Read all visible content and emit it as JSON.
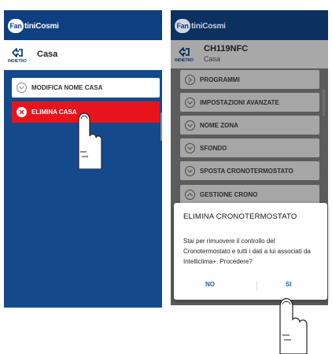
{
  "brand": {
    "logo_badge": "Fan",
    "logo_text": "tiniCosmi"
  },
  "colors": {
    "header_blue": "#0e3f80",
    "danger_red": "#e8141c",
    "dialog_button": "#1f5ea8"
  },
  "left_screen": {
    "back_label": "INDIETRO",
    "title": "Casa",
    "menu": [
      {
        "label": "MODIFICA NOME CASA",
        "icon": "chevron-down-icon"
      },
      {
        "label": "ELIMINA CASA",
        "icon": "close-icon"
      }
    ]
  },
  "right_screen": {
    "back_label": "INDIETRO",
    "title": "CH119NFC",
    "subtitle": "Casa",
    "menu": [
      {
        "label": "PROGRAMMI",
        "icon": "chevron-right-icon"
      },
      {
        "label": "IMPOSTAZIONI AVANZATE",
        "icon": "chevron-down-icon"
      },
      {
        "label": "NOME ZONA",
        "icon": "chevron-down-icon"
      },
      {
        "label": "SFONDO",
        "icon": "chevron-down-icon"
      },
      {
        "label": "SPOSTA CRONOTERMOSTATO",
        "icon": "chevron-down-icon"
      },
      {
        "label": "GESTIONE CRONO",
        "icon": "chevron-up-icon"
      }
    ],
    "dialog": {
      "title": "ELIMINA CRONOTERMOSTATO",
      "message": "Stai per rimuovere il controllo del Cronotermostato e tutti i dati a lui associati da Intelliclima+. Procedere?",
      "no_label": "NO",
      "yes_label": "SI"
    }
  }
}
